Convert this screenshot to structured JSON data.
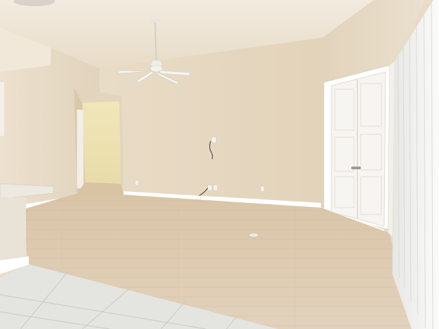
{
  "scene": {
    "description_free": true,
    "colors": {
      "ceiling": "#efe6d6",
      "back_wall": "#e6d8c1",
      "left_wall": "#e9ddc9",
      "right_wall": "#e4d6bf",
      "hallway": "#efe4b2",
      "floor": "#dcc8ae",
      "tile": "#e4e4e0",
      "trim": "#ffffff",
      "door": "#f7f5f1",
      "blinds": "#f4f4f2"
    },
    "icons": [
      "ceiling-fan-icon",
      "double-door-icon",
      "vertical-blinds-icon",
      "counter-icon",
      "outlet-icon"
    ]
  }
}
